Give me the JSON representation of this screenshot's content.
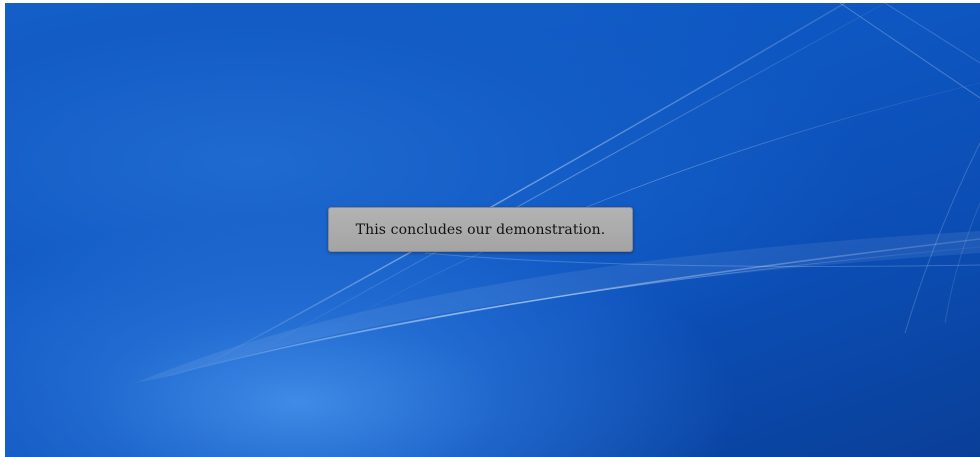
{
  "desktop": {
    "wallpaper": "blue-light-streaks",
    "colors": {
      "base": "#0e57c2",
      "highlight": "#3f8be6",
      "dark": "#0a3f98"
    }
  },
  "message": {
    "text": "This concludes our demonstration.",
    "background": "#a9a9a9",
    "text_color": "#111111"
  }
}
